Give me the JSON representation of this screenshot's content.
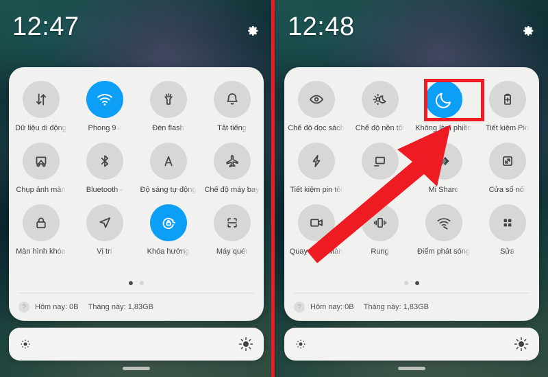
{
  "left_phone": {
    "status": {
      "clock": "12:47",
      "settings_icon": "gear-icon"
    },
    "panel": {
      "tiles": [
        {
          "label": "Dữ liệu di động",
          "icon": "mobile-data-icon",
          "active": false,
          "caret": false
        },
        {
          "label": "Phong 9",
          "icon": "wifi-icon",
          "active": true,
          "caret": true
        },
        {
          "label": "Đèn flash",
          "icon": "flashlight-icon",
          "active": false,
          "caret": false
        },
        {
          "label": "Tắt tiếng",
          "icon": "bell-icon",
          "active": false,
          "caret": false
        },
        {
          "label": "Chụp ảnh màn",
          "icon": "screenshot-icon",
          "active": false,
          "caret": false
        },
        {
          "label": "Bluetooth",
          "icon": "bluetooth-icon",
          "active": false,
          "caret": true
        },
        {
          "label": "Độ sáng tự động",
          "icon": "auto-brightness-a-icon",
          "active": false,
          "caret": false
        },
        {
          "label": "Chế độ máy bay",
          "icon": "airplane-icon",
          "active": false,
          "caret": false
        },
        {
          "label": "Màn hình khóa",
          "icon": "lock-icon",
          "active": false,
          "caret": false
        },
        {
          "label": "Vị trí",
          "icon": "location-arrow-icon",
          "active": false,
          "caret": false
        },
        {
          "label": "Khóa hướng",
          "icon": "rotation-lock-icon",
          "active": true,
          "caret": false
        },
        {
          "label": "Máy quét",
          "icon": "scanner-icon",
          "active": false,
          "caret": false
        }
      ],
      "page_dots": {
        "count": 2,
        "active_index": 0
      },
      "usage": {
        "help_glyph": "?",
        "today": "Hôm nay: 0B",
        "month": "Tháng này: 1,83GB"
      }
    },
    "brightness": {
      "low_icon": "brightness-low-icon",
      "high_icon": "brightness-high-icon"
    }
  },
  "right_phone": {
    "status": {
      "clock": "12:48",
      "settings_icon": "gear-icon"
    },
    "panel": {
      "tiles": [
        {
          "label": "Chế độ đọc sách",
          "icon": "eye-icon",
          "active": false,
          "caret": false
        },
        {
          "label": "Chế độ nền tối",
          "icon": "dark-mode-icon",
          "active": false,
          "caret": false
        },
        {
          "label": "Không làm phiền",
          "icon": "moon-icon",
          "active": true,
          "caret": false
        },
        {
          "label": "Tiết kiệm Pin",
          "icon": "battery-saver-icon",
          "active": false,
          "caret": false
        },
        {
          "label": "Tiết kiệm pin tối",
          "icon": "ultra-battery-saver-icon",
          "active": false,
          "caret": false
        },
        {
          "label": "",
          "icon": "cast-icon",
          "active": false,
          "caret": false
        },
        {
          "label": "Mi Share",
          "icon": "mi-share-icon",
          "active": false,
          "caret": false
        },
        {
          "label": "Cửa sổ nổi",
          "icon": "floating-window-icon",
          "active": false,
          "caret": false
        },
        {
          "label": "Quay phim Màn",
          "icon": "screen-record-icon",
          "active": false,
          "caret": false
        },
        {
          "label": "Rung",
          "icon": "vibrate-icon",
          "active": false,
          "caret": false
        },
        {
          "label": "Điểm phát sóng",
          "icon": "hotspot-icon",
          "active": false,
          "caret": false
        },
        {
          "label": "Sửa",
          "icon": "edit-grid-icon",
          "active": false,
          "caret": false
        }
      ],
      "page_dots": {
        "count": 2,
        "active_index": 1
      },
      "usage": {
        "help_glyph": "?",
        "today": "Hôm nay: 0B",
        "month": "Tháng này: 1,83GB"
      }
    },
    "brightness": {
      "low_icon": "brightness-low-icon",
      "high_icon": "brightness-high-icon"
    }
  },
  "annotations": {
    "divider_color": "#ee1c22",
    "highlight_color": "#ee1c22",
    "arrow_color": "#ee1c22",
    "highlight_target": "Không làm phiền"
  },
  "theme": {
    "accent_on": "#0d9ef5",
    "tile_bg": "#d7d7d5",
    "panel_bg": "#f1f1ef",
    "label_color": "#3d4245"
  }
}
